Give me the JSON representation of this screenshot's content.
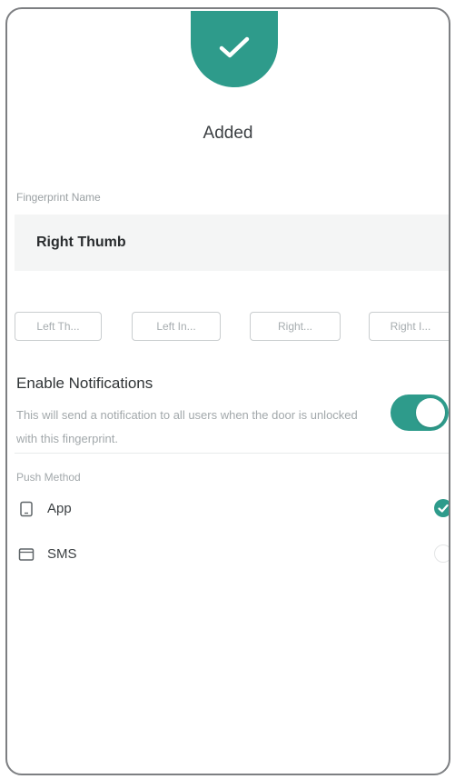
{
  "status": {
    "icon": "checkmark-icon",
    "text": "Added",
    "color": "#2e9b8b"
  },
  "fingerprint": {
    "label": "Fingerprint Name",
    "value": "Right Thumb"
  },
  "presets": [
    {
      "label": "Left Th..."
    },
    {
      "label": "Left In..."
    },
    {
      "label": "Right..."
    },
    {
      "label": "Right I..."
    }
  ],
  "notifications": {
    "title": "Enable Notifications",
    "description": "This will send a notification to all users when the door is unlocked with this fingerprint.",
    "enabled": true
  },
  "push_method": {
    "label": "Push Method",
    "options": [
      {
        "label": "App",
        "icon": "phone-icon",
        "selected": true
      },
      {
        "label": "SMS",
        "icon": "message-icon",
        "selected": false
      }
    ]
  },
  "accent_color": "#2e9b8b"
}
